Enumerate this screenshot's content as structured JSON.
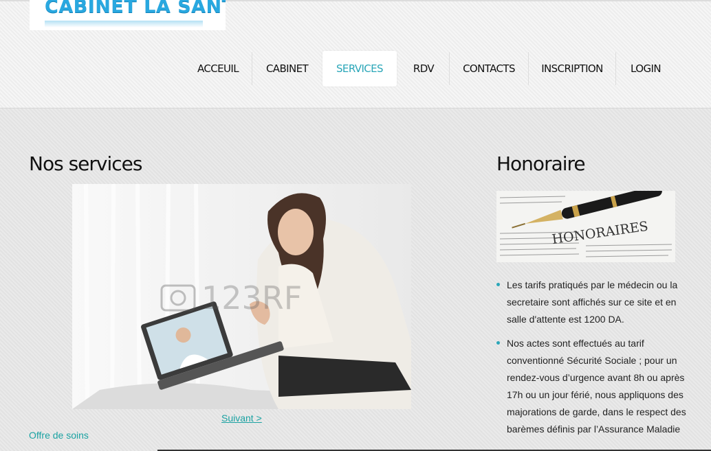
{
  "site": {
    "logo_text": "CABINET LA SANTE"
  },
  "nav": {
    "items": [
      "ACCEUIL",
      "CABINET",
      "SERVICES",
      "RDV",
      "CONTACTS",
      "INSCRIPTION",
      "LOGIN"
    ],
    "active": "SERVICES"
  },
  "main": {
    "title": "Nos services",
    "watermark": "123RF",
    "next_link": "Suivant >",
    "offer_link": "Offre de soins"
  },
  "sidebar": {
    "title": "Honoraire",
    "image_text": "HONORAIRES",
    "bullets": [
      "Les tarifs pratiqués par le médecin ou la secretaire sont affichés sur ce site et en salle d'attente est 1200 DA.",
      "Nos actes sont effectués au tarif conventionné Sécurité Sociale ; pour un rendez-vous d’urgence avant 8h ou après 17h ou un jour férié, nous appliquons des majorations de garde, dans le respect des barèmes définis par l’Assurance Maladie"
    ]
  },
  "colors": {
    "accent": "#2aa6b8",
    "logo": "#29a8e0"
  }
}
